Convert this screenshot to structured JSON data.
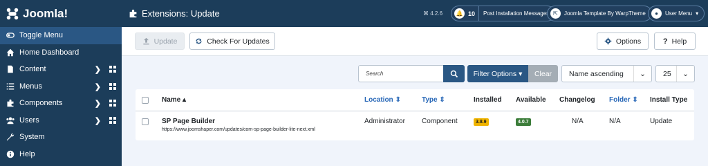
{
  "brand": {
    "name": "Joomla!"
  },
  "sidebar": {
    "items": [
      {
        "label": "Toggle Menu",
        "icon": "toggle-icon"
      },
      {
        "label": "Home Dashboard",
        "icon": "home-icon"
      },
      {
        "label": "Content",
        "icon": "file-icon"
      },
      {
        "label": "Menus",
        "icon": "list-icon"
      },
      {
        "label": "Components",
        "icon": "puzzle-icon"
      },
      {
        "label": "Users",
        "icon": "users-icon"
      },
      {
        "label": "System",
        "icon": "wrench-icon"
      },
      {
        "label": "Help",
        "icon": "info-icon"
      }
    ]
  },
  "header": {
    "title": "Extensions: Update",
    "version": "4.2.6",
    "notifications_count": "10",
    "post_install_label": "Post Installation Messages",
    "template_label": "Joomla Template By WarpTheme",
    "user_menu_label": "User Menu"
  },
  "toolbar": {
    "update_label": "Update",
    "check_label": "Check For Updates",
    "options_label": "Options",
    "help_label": "Help"
  },
  "filters": {
    "search_placeholder": "Search",
    "filter_options_label": "Filter Options",
    "clear_label": "Clear",
    "sort_value": "Name ascending",
    "limit_value": "25"
  },
  "table": {
    "columns": [
      "Name",
      "Location",
      "Type",
      "Installed",
      "Available",
      "Changelog",
      "Folder",
      "Install Type"
    ],
    "rows": [
      {
        "name": "SP Page Builder",
        "url": "https://www.joomshaper.com/updates/com-sp-page-builder-lite-next.xml",
        "location": "Administrator",
        "type": "Component",
        "installed": "3.8.9",
        "available": "4.0.7",
        "changelog": "N/A",
        "folder": "N/A",
        "install_type": "Update"
      }
    ]
  },
  "colors": {
    "navy": "#1c3d5a",
    "primary": "#2a5784",
    "installed_badge": "#f0b400",
    "available_badge": "#3c7d3a"
  }
}
